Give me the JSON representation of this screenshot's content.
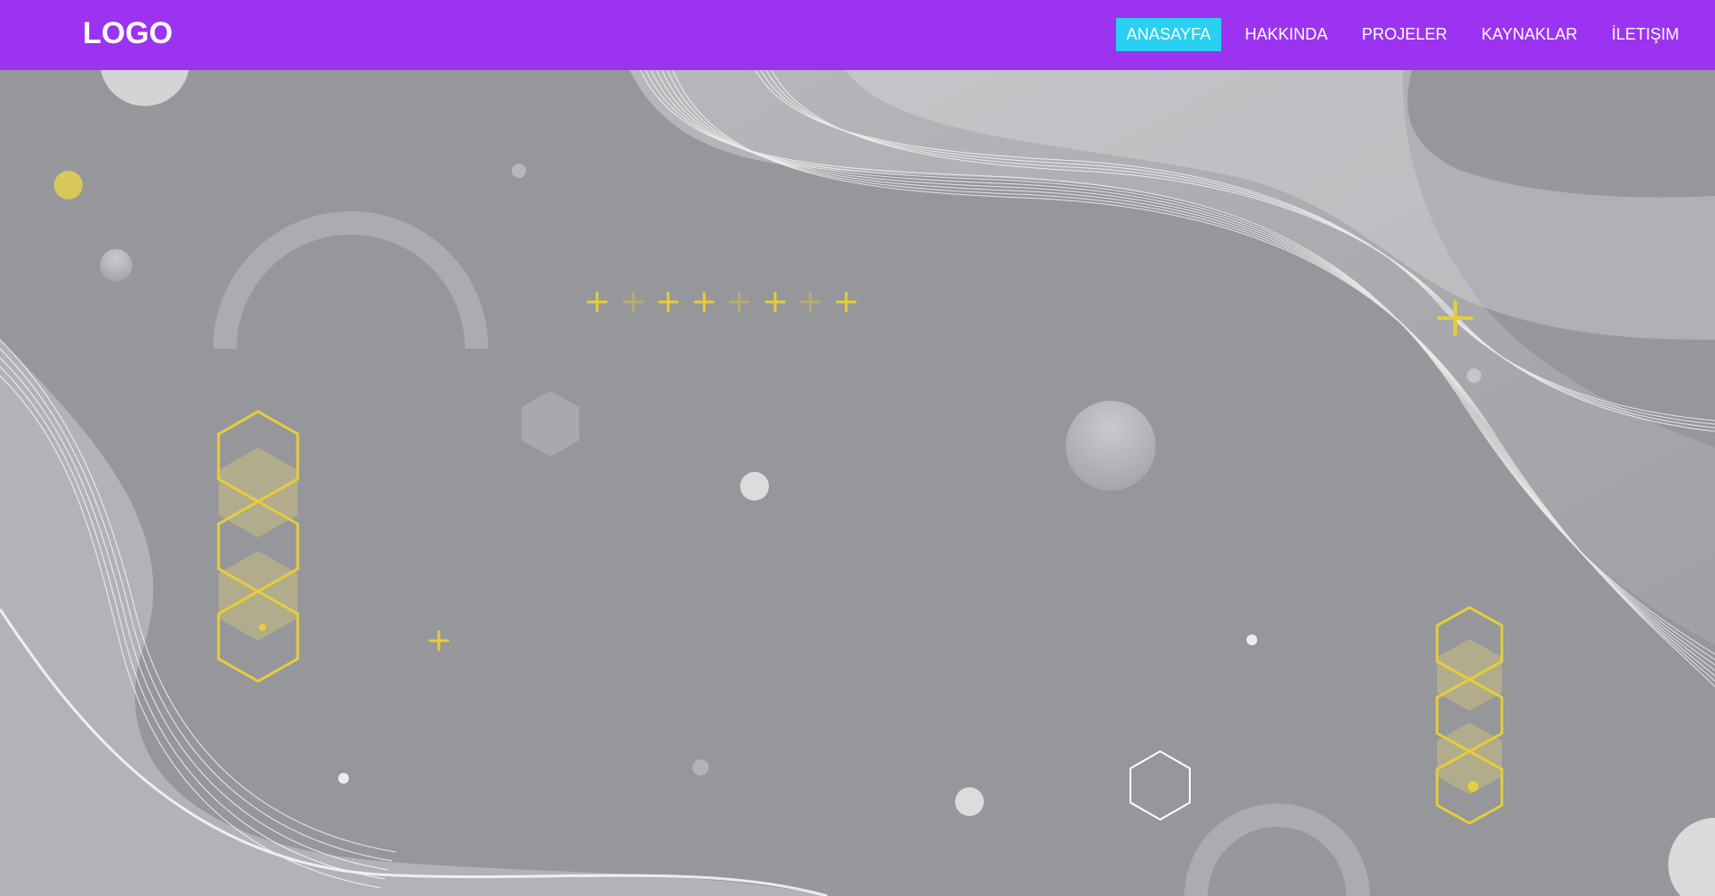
{
  "header": {
    "logo_text": "LOGO",
    "nav": [
      {
        "label": "ANASAYFA",
        "active": true
      },
      {
        "label": "HAKKINDA",
        "active": false
      },
      {
        "label": "PROJELER",
        "active": false
      },
      {
        "label": "KAYNAKLAR",
        "active": false
      },
      {
        "label": "İLETIŞIM",
        "active": false
      }
    ]
  },
  "theme": {
    "nav_background": "#9b33f1",
    "nav_active": "#29d0f2",
    "hero_background": "#96979b",
    "accent_yellow": "#e6cd3a"
  }
}
